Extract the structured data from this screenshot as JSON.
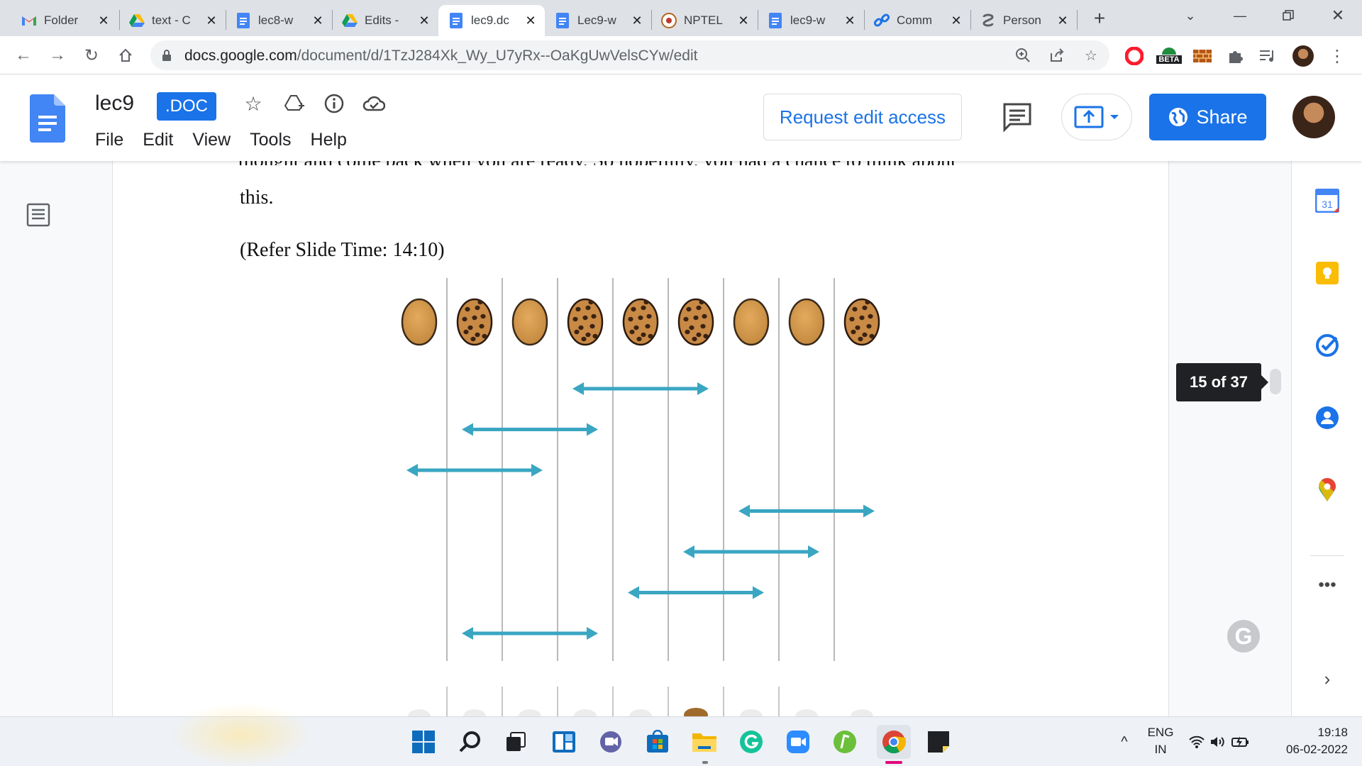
{
  "browser": {
    "tabs": [
      {
        "label": "Folder",
        "icon": "gmail-icon",
        "active": false
      },
      {
        "label": "text - C",
        "icon": "drive-icon",
        "active": false
      },
      {
        "label": "lec8-w",
        "icon": "docs-icon",
        "active": false
      },
      {
        "label": "Edits -",
        "icon": "drive-icon",
        "active": false
      },
      {
        "label": "lec9.dc",
        "icon": "docs-icon",
        "active": true
      },
      {
        "label": "Lec9-w",
        "icon": "docs-icon",
        "active": false
      },
      {
        "label": "NPTEL",
        "icon": "nptel-icon",
        "active": false
      },
      {
        "label": "lec9-w",
        "icon": "docs-icon",
        "active": false
      },
      {
        "label": "Comm",
        "icon": "link-icon",
        "active": false
      },
      {
        "label": "Person",
        "icon": "grammarly-ext-icon",
        "active": false
      }
    ],
    "url_domain": "docs.google.com",
    "url_path": "/document/d/1TzJ284Xk_Wy_U7yRx--OaKgUwVelsCYw/edit",
    "beta_label": "BETA"
  },
  "docs": {
    "title": "lec9",
    "badge": ".DOC",
    "menu": [
      "File",
      "Edit",
      "View",
      "Tools",
      "Help"
    ],
    "request_edit": "Request edit access",
    "share": "Share",
    "accent": "#1a73e8"
  },
  "document": {
    "cut_line": "thought and come back when you are ready. So hopefully, you had a chance to think about",
    "line1": "this.",
    "line2": "(Refer Slide Time: 14:10)"
  },
  "slide": {
    "items": [
      "plain",
      "chip",
      "plain",
      "chip",
      "chip",
      "chip",
      "plain",
      "plain",
      "chip"
    ],
    "arrows": [
      [
        3,
        5
      ],
      [
        1,
        3
      ],
      [
        0,
        2
      ],
      [
        6,
        8
      ],
      [
        5,
        7
      ],
      [
        4,
        6
      ],
      [
        1,
        3
      ]
    ],
    "arrow_color": "#3aa6c2"
  },
  "page_counter": "15 of 37",
  "taskbar": {
    "lang_top": "ENG",
    "lang_bottom": "IN",
    "time": "19:18",
    "date": "06-02-2022"
  }
}
